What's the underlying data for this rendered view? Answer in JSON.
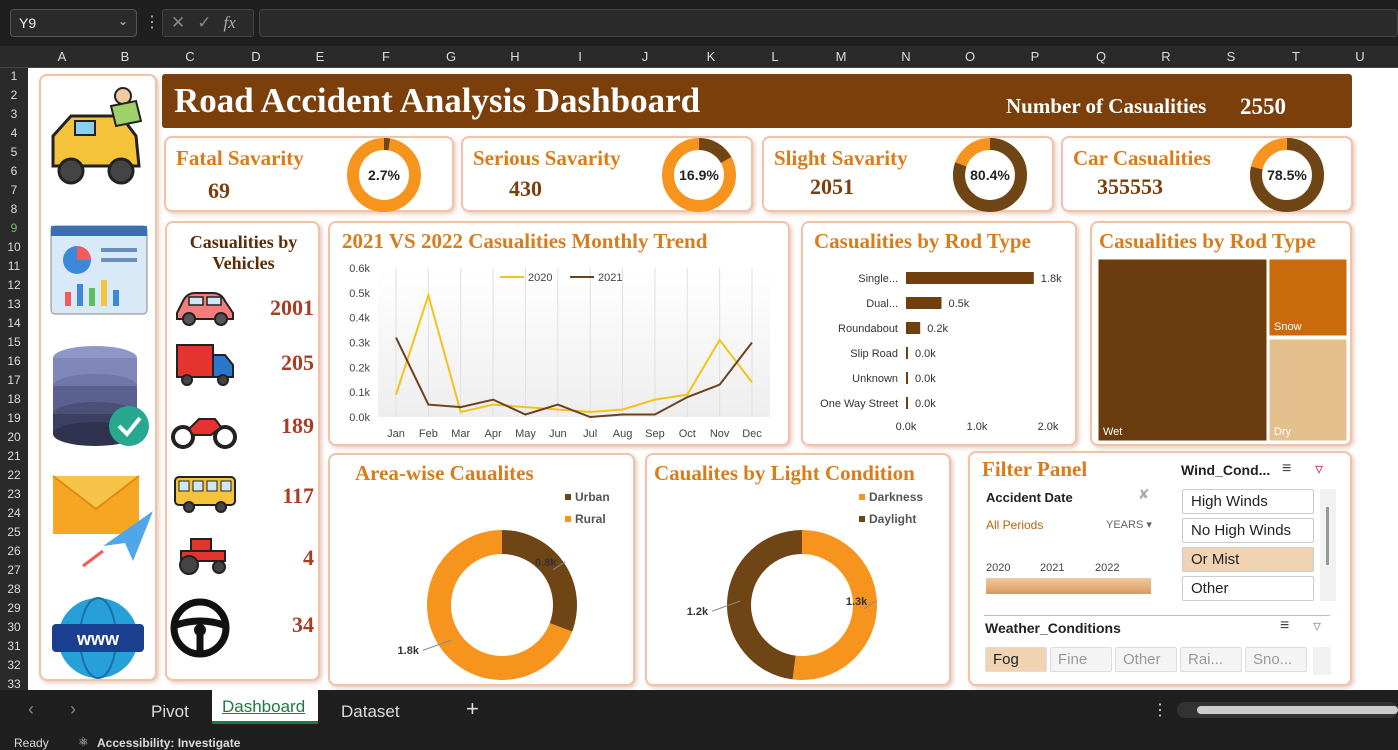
{
  "formula_bar": {
    "name_box": "Y9",
    "fx": "fx"
  },
  "columns": [
    "A",
    "B",
    "C",
    "D",
    "E",
    "F",
    "G",
    "H",
    "I",
    "J",
    "K",
    "L",
    "M",
    "N",
    "O",
    "P",
    "Q",
    "R",
    "S",
    "T",
    "U"
  ],
  "rows": [
    "1",
    "2",
    "3",
    "4",
    "5",
    "6",
    "7",
    "8",
    "9",
    "10",
    "11",
    "12",
    "13",
    "14",
    "15",
    "16",
    "17",
    "18",
    "19",
    "20",
    "21",
    "22",
    "23",
    "24",
    "25",
    "26",
    "27",
    "28",
    "29",
    "30",
    "31",
    "32",
    "33"
  ],
  "header": {
    "title": "Road Accident Analysis Dashboard",
    "casualties_label": "Number of Casualities",
    "casualties_value": "2550"
  },
  "kpis": [
    {
      "label": "Fatal Savarity",
      "value": "69",
      "pct_text": "2.7%",
      "pct": 2.7
    },
    {
      "label": "Serious Savarity",
      "value": "430",
      "pct_text": "16.9%",
      "pct": 16.9
    },
    {
      "label": "Slight Savarity",
      "value": "2051",
      "pct_text": "80.4%",
      "pct": 80.4
    },
    {
      "label": "Car Casualities",
      "value": "355553",
      "pct_text": "78.5%",
      "pct": 78.5
    }
  ],
  "vehicles": {
    "title": "Casualities by Vehicles",
    "items": [
      {
        "icon": "car-icon",
        "value": "2001"
      },
      {
        "icon": "truck-icon",
        "value": "205"
      },
      {
        "icon": "motorcycle-icon",
        "value": "189"
      },
      {
        "icon": "bus-icon",
        "value": "117"
      },
      {
        "icon": "tractor-icon",
        "value": "4"
      },
      {
        "icon": "steering-wheel-icon",
        "value": "34"
      }
    ]
  },
  "trend_title": "2021 VS 2022 Casualities Monthly Trend",
  "road_title": "Casualities by Rod Type",
  "surface_title": "Casualities by Rod Type",
  "area_title": "Area-wise Caualites",
  "light_title": "Caualites by Light Condition",
  "chart_data": [
    {
      "type": "line",
      "x": [
        "Jan",
        "Feb",
        "Mar",
        "Apr",
        "May",
        "Jun",
        "Jul",
        "Aug",
        "Sep",
        "Oct",
        "Nov",
        "Dec"
      ],
      "series": [
        {
          "name": "2020",
          "color": "#f2c318",
          "values": [
            0.09,
            0.49,
            0.02,
            0.05,
            0.04,
            0.03,
            0.02,
            0.03,
            0.07,
            0.09,
            0.31,
            0.14
          ]
        },
        {
          "name": "2021",
          "color": "#6b4220",
          "values": [
            0.32,
            0.05,
            0.04,
            0.07,
            0.01,
            0.05,
            0.0,
            0.01,
            0.01,
            0.08,
            0.13,
            0.3
          ]
        }
      ],
      "yticks": [
        "0.0k",
        "0.1k",
        "0.2k",
        "0.3k",
        "0.4k",
        "0.5k",
        "0.6k"
      ],
      "ylim": [
        0,
        0.6
      ]
    },
    {
      "type": "bar",
      "categories": [
        "Single...",
        "Dual...",
        "Roundabout",
        "Slip Road",
        "Unknown",
        "One Way Street"
      ],
      "values": [
        1.8,
        0.5,
        0.2,
        0.0,
        0.0,
        0.0
      ],
      "labels": [
        "1.8k",
        "0.5k",
        "0.2k",
        "0.0k",
        "0.0k",
        "0.0k"
      ],
      "xticks": [
        "0.0k",
        "1.0k",
        "2.0k"
      ],
      "xlim": [
        0,
        2.0
      ]
    },
    {
      "type": "treemap",
      "categories": [
        "Wet",
        "Snow",
        "Dry"
      ],
      "colors": [
        "#6b3c10",
        "#c96a0c",
        "#e5c08f"
      ]
    },
    {
      "type": "pie",
      "categories": [
        "Urban",
        "Rural"
      ],
      "values": [
        0.8,
        1.8
      ],
      "labels": [
        "0.8k",
        "1.8k"
      ],
      "colors": [
        "#6f4516",
        "#f7941d"
      ]
    },
    {
      "type": "pie",
      "categories": [
        "Darkness",
        "Daylight"
      ],
      "values": [
        1.3,
        1.2
      ],
      "labels": [
        "1.3k",
        "1.2k"
      ],
      "colors": [
        "#f7941d",
        "#6f4516"
      ]
    }
  ],
  "filter_panel": {
    "title": "Filter Panel",
    "accident_date": "Accident Date",
    "all_periods": "All Periods",
    "years": "YEARS",
    "timeline_years": [
      "2020",
      "2021",
      "2022"
    ],
    "wind_title": "Wind_Cond...",
    "wind_options": [
      "High Winds",
      "No High Winds",
      "Or Mist",
      "Other"
    ],
    "weather_title": "Weather_Conditions",
    "weather_options": [
      "Fog",
      "Fine",
      "Other",
      "Rai...",
      "Sno..."
    ]
  },
  "sheet_tabs": [
    "Pivot",
    "Dashboard",
    "Dataset"
  ],
  "status": {
    "ready": "Ready",
    "accessibility": "Accessibility: Investigate"
  }
}
